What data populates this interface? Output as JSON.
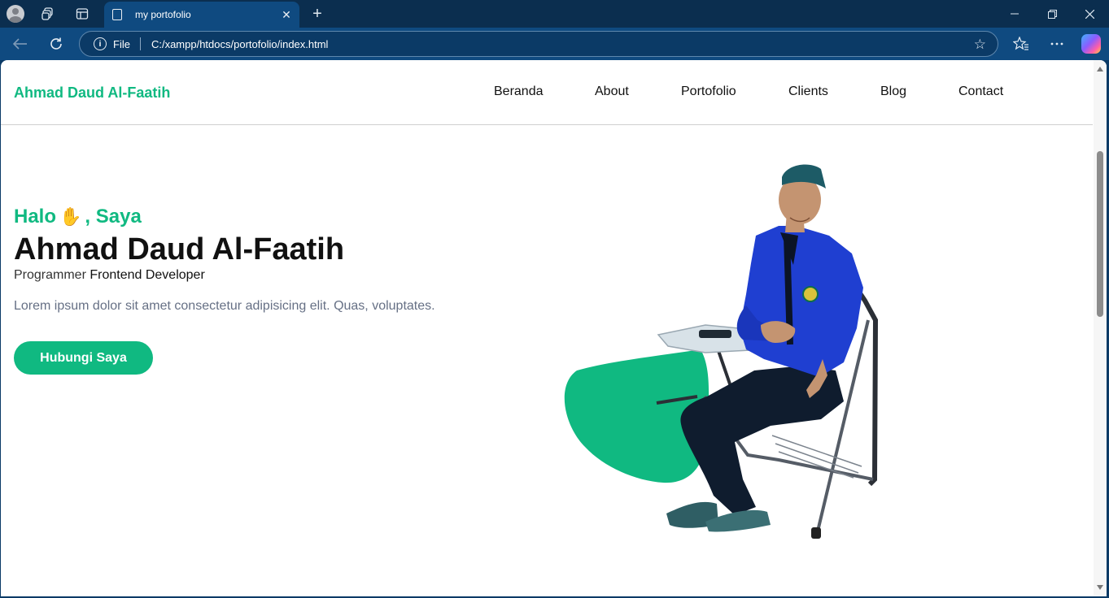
{
  "browser": {
    "tab_title": "my portofolio",
    "tab_close": "✕",
    "new_tab": "+",
    "address_scheme": "File",
    "address_url": "C:/xampp/htdocs/portofolio/index.html"
  },
  "site": {
    "brand": "Ahmad Daud Al-Faatih",
    "nav": [
      "Beranda",
      "About",
      "Portofolio",
      "Clients",
      "Blog",
      "Contact"
    ]
  },
  "hero": {
    "greeting_before": "Halo",
    "greeting_emoji": "✋",
    "greeting_after": ", Saya",
    "name": "Ahmad Daud Al-Faatih",
    "role_prefix": "Programmer",
    "role_main": "Frontend Developer",
    "description": "Lorem ipsum dolor sit amet consectetur adipisicing elit. Quas, voluptates.",
    "cta_label": "Hubungi Saya"
  },
  "colors": {
    "accent": "#10b981",
    "browser_frame": "#0b2e4f",
    "jacket": "#1f3fd1"
  }
}
